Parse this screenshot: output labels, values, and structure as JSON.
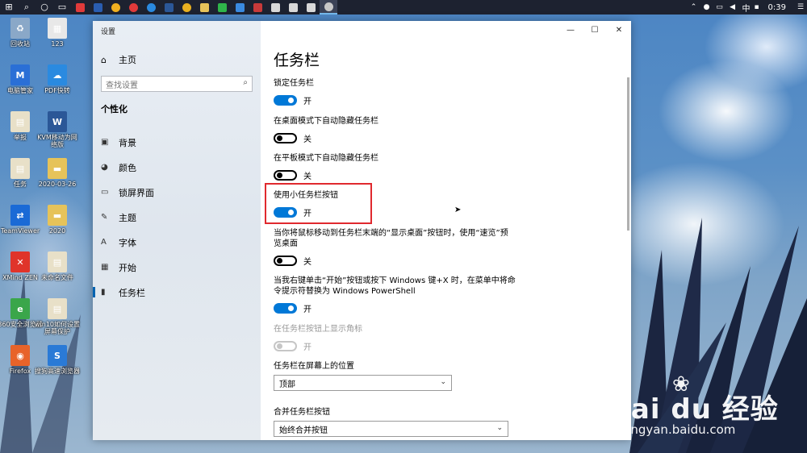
{
  "taskbar": {
    "apps": [
      {
        "name": "start-button",
        "glyph": "⊞"
      },
      {
        "name": "search-icon",
        "glyph": "⌕"
      },
      {
        "name": "cortana-icon",
        "glyph": "○"
      },
      {
        "name": "task-view-icon",
        "glyph": "▭"
      }
    ],
    "tray": {
      "lang": "中",
      "time": "0:39"
    }
  },
  "desktop_icons": [
    {
      "label": "回收站",
      "color": "#8aa8c8",
      "glyph": "♻"
    },
    {
      "label": "123",
      "color": "#e8e8e8",
      "glyph": "▦"
    },
    {
      "label": "电脑管家",
      "color": "#2a6fd6",
      "glyph": "M"
    },
    {
      "label": "PDF快转",
      "color": "#2a8ae0",
      "glyph": "☁"
    },
    {
      "label": "举报",
      "color": "#e8e0c8",
      "glyph": "▤"
    },
    {
      "label": "KVM移动为网络版",
      "color": "#2b5797",
      "glyph": "W"
    },
    {
      "label": "任务",
      "color": "#e8e0c8",
      "glyph": "▤"
    },
    {
      "label": "2020-03-26",
      "color": "#e6c35a",
      "glyph": "▬"
    },
    {
      "label": "TeamViewer",
      "color": "#1a6ad6",
      "glyph": "⇄"
    },
    {
      "label": "2020",
      "color": "#e6c35a",
      "glyph": "▬"
    },
    {
      "label": "XMind ZEN",
      "color": "#e0342a",
      "glyph": "✕"
    },
    {
      "label": "未命名文件",
      "color": "#e8e0c8",
      "glyph": "▤"
    },
    {
      "label": "360安全浏览器",
      "color": "#3aa64a",
      "glyph": "e"
    },
    {
      "label": "win10如何设置屏幕保护",
      "color": "#e8e0c8",
      "glyph": "▤"
    },
    {
      "label": "Firefox",
      "color": "#e8632a",
      "glyph": "◉"
    },
    {
      "label": "搜狗高速浏览器",
      "color": "#2a7ad6",
      "glyph": "S"
    }
  ],
  "window": {
    "title": "设置",
    "caption": {
      "minimize": "—",
      "maximize": "☐",
      "close": "✕"
    }
  },
  "sidebar": {
    "home": "主页",
    "search_placeholder": "查找设置",
    "section": "个性化",
    "items": [
      {
        "label": "背景",
        "icon": "▣"
      },
      {
        "label": "颜色",
        "icon": "◕"
      },
      {
        "label": "锁屏界面",
        "icon": "▭"
      },
      {
        "label": "主题",
        "icon": "✎"
      },
      {
        "label": "字体",
        "icon": "A"
      },
      {
        "label": "开始",
        "icon": "▦"
      },
      {
        "label": "任务栏",
        "icon": "▮"
      }
    ]
  },
  "main": {
    "title": "任务栏",
    "settings": [
      {
        "label": "锁定任务栏",
        "state": "开",
        "on": true
      },
      {
        "label": "在桌面模式下自动隐藏任务栏",
        "state": "关",
        "on": false
      },
      {
        "label": "在平板模式下自动隐藏任务栏",
        "state": "关",
        "on": false
      },
      {
        "label": "使用小任务栏按钮",
        "state": "开",
        "on": true
      },
      {
        "label": "当你将鼠标移动到任务栏末端的“显示桌面”按钮时，使用“速览”预览桌面",
        "state": "关",
        "on": false
      },
      {
        "label": "当我右键单击“开始”按钮或按下 Windows 键+X 时，在菜单中将命令提示符替换为 Windows PowerShell",
        "state": "开",
        "on": true
      },
      {
        "label": "在任务栏按钮上显示角标",
        "state": "开",
        "on": false,
        "disabled": true
      }
    ],
    "position_label": "任务栏在屏幕上的位置",
    "position_value": "顶部",
    "combine_label": "合并任务栏按钮",
    "combine_value": "始终合并按钮"
  },
  "watermark": {
    "brand": "Bai du 经验",
    "url": "jingyan.baidu.com"
  }
}
